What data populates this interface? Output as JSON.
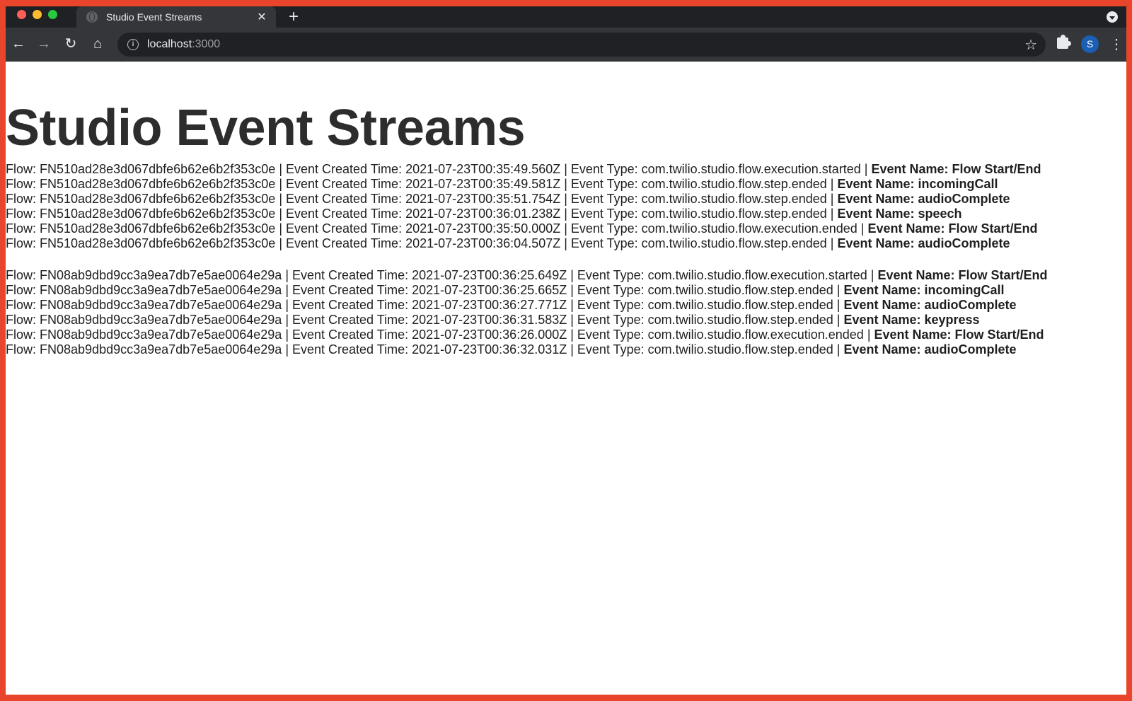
{
  "browser": {
    "tab_title": "Studio Event Streams",
    "url_host": "localhost",
    "url_port": ":3000",
    "avatar_initial": "S",
    "colors": {
      "frame_border": "#e8452c",
      "tabstrip": "#202124",
      "toolbar": "#35363a",
      "avatar": "#1a5fb4",
      "traffic_red": "#ff5f57",
      "traffic_yellow": "#febc2e",
      "traffic_green": "#28c840"
    }
  },
  "page": {
    "heading": "Studio Event Streams",
    "labels": {
      "flow": "Flow: ",
      "created": " | Event Created Time: ",
      "type": " | Event Type: ",
      "name": " | ",
      "name_label": "Event Name: "
    },
    "groups": [
      {
        "events": [
          {
            "flow": "FN510ad28e3d067dbfe6b62e6b2f353c0e",
            "time": "2021-07-23T00:35:49.560Z",
            "type": "com.twilio.studio.flow.execution.started",
            "name": "Flow Start/End"
          },
          {
            "flow": "FN510ad28e3d067dbfe6b62e6b2f353c0e",
            "time": "2021-07-23T00:35:49.581Z",
            "type": "com.twilio.studio.flow.step.ended",
            "name": "incomingCall"
          },
          {
            "flow": "FN510ad28e3d067dbfe6b62e6b2f353c0e",
            "time": "2021-07-23T00:35:51.754Z",
            "type": "com.twilio.studio.flow.step.ended",
            "name": "audioComplete"
          },
          {
            "flow": "FN510ad28e3d067dbfe6b62e6b2f353c0e",
            "time": "2021-07-23T00:36:01.238Z",
            "type": "com.twilio.studio.flow.step.ended",
            "name": "speech"
          },
          {
            "flow": "FN510ad28e3d067dbfe6b62e6b2f353c0e",
            "time": "2021-07-23T00:35:50.000Z",
            "type": "com.twilio.studio.flow.execution.ended",
            "name": "Flow Start/End"
          },
          {
            "flow": "FN510ad28e3d067dbfe6b62e6b2f353c0e",
            "time": "2021-07-23T00:36:04.507Z",
            "type": "com.twilio.studio.flow.step.ended",
            "name": "audioComplete"
          }
        ]
      },
      {
        "events": [
          {
            "flow": "FN08ab9dbd9cc3a9ea7db7e5ae0064e29a",
            "time": "2021-07-23T00:36:25.649Z",
            "type": "com.twilio.studio.flow.execution.started",
            "name": "Flow Start/End"
          },
          {
            "flow": "FN08ab9dbd9cc3a9ea7db7e5ae0064e29a",
            "time": "2021-07-23T00:36:25.665Z",
            "type": "com.twilio.studio.flow.step.ended",
            "name": "incomingCall"
          },
          {
            "flow": "FN08ab9dbd9cc3a9ea7db7e5ae0064e29a",
            "time": "2021-07-23T00:36:27.771Z",
            "type": "com.twilio.studio.flow.step.ended",
            "name": "audioComplete"
          },
          {
            "flow": "FN08ab9dbd9cc3a9ea7db7e5ae0064e29a",
            "time": "2021-07-23T00:36:31.583Z",
            "type": "com.twilio.studio.flow.step.ended",
            "name": "keypress"
          },
          {
            "flow": "FN08ab9dbd9cc3a9ea7db7e5ae0064e29a",
            "time": "2021-07-23T00:36:26.000Z",
            "type": "com.twilio.studio.flow.execution.ended",
            "name": "Flow Start/End"
          },
          {
            "flow": "FN08ab9dbd9cc3a9ea7db7e5ae0064e29a",
            "time": "2021-07-23T00:36:32.031Z",
            "type": "com.twilio.studio.flow.step.ended",
            "name": "audioComplete"
          }
        ]
      }
    ]
  }
}
